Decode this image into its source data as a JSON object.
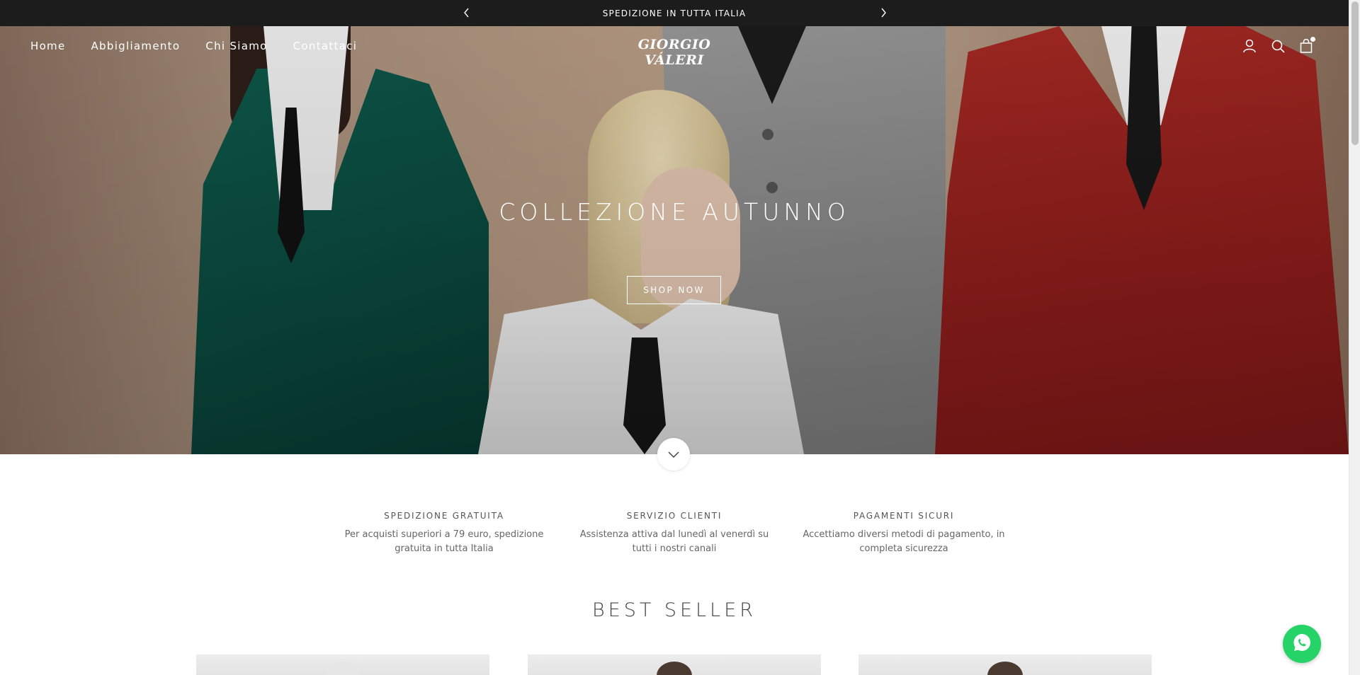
{
  "announcement": {
    "text": "SPEDIZIONE IN TUTTA ITALIA",
    "prev_icon": "chevron-left-icon",
    "next_icon": "chevron-right-icon"
  },
  "header": {
    "nav": [
      {
        "label": "Home"
      },
      {
        "label": "Abbigliamento"
      },
      {
        "label": "Chi Siamo"
      },
      {
        "label": "Contattaci"
      }
    ],
    "logo": "GIORGIO VÁLERI",
    "icons": [
      "account-icon",
      "search-icon",
      "cart-icon"
    ]
  },
  "hero": {
    "title": "COLLEZIONE AUTUNNO",
    "button": "SHOP NOW",
    "scroll_icon": "chevron-down-icon"
  },
  "features": [
    {
      "title": "SPEDIZIONE GRATUITA",
      "text": "Per acquisti superiori a 79 euro, spedizione gratuita in tutta Italia"
    },
    {
      "title": "SERVIZIO CLIENTI",
      "text": "Assistenza attiva dal lunedì al venerdì su tutti i nostri canali"
    },
    {
      "title": "PAGAMENTI SICURI",
      "text": "Accettiamo diversi metodi di pagamento, in completa sicurezza"
    }
  ],
  "best_seller": {
    "title": "BEST SELLER"
  },
  "colors": {
    "announcement_bg": "#1c1c1c",
    "whatsapp": "#25d366",
    "text": "#444444"
  }
}
